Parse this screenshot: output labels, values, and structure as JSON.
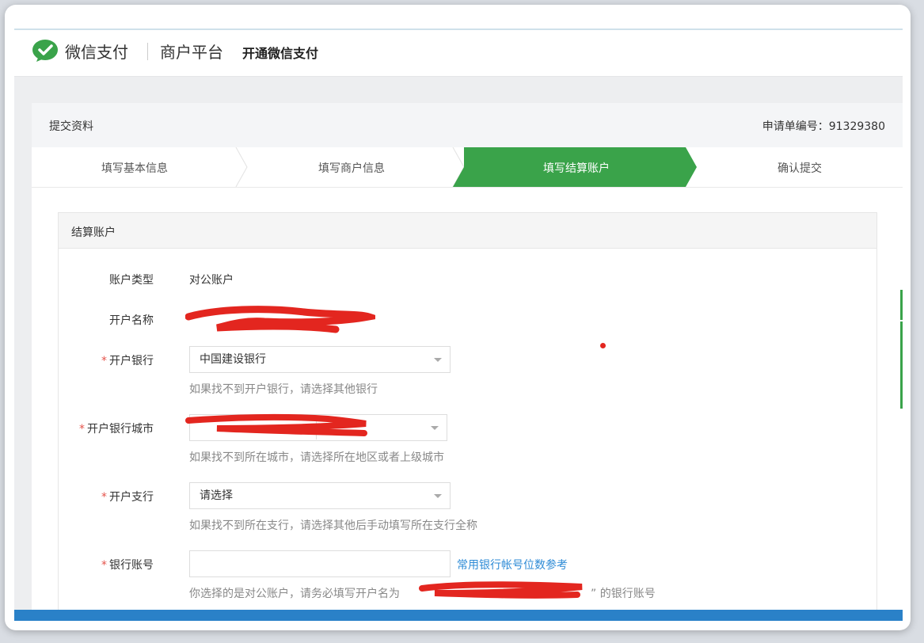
{
  "header": {
    "brand": "微信支付",
    "platform": "商户平台",
    "subtitle": "开通微信支付"
  },
  "panel": {
    "title": "提交资料",
    "application_no": "申请单编号：91329380"
  },
  "steps": [
    {
      "label": "填写基本信息",
      "active": false
    },
    {
      "label": "填写商户信息",
      "active": false
    },
    {
      "label": "填写结算账户",
      "active": true
    },
    {
      "label": "确认提交",
      "active": false
    }
  ],
  "section": {
    "title": "结算账户"
  },
  "form": {
    "account_type": {
      "label": "账户类型",
      "value": "对公账户"
    },
    "account_name": {
      "label": "开户名称"
    },
    "bank": {
      "label": "开户银行",
      "value": "中国建设银行",
      "hint": "如果找不到开户银行，请选择其他银行"
    },
    "bank_city": {
      "label": "开户银行城市",
      "hint": "如果找不到所在城市，请选择所在地区或者上级城市"
    },
    "branch": {
      "label": "开户支行",
      "value": "请选择",
      "hint": "如果找不到所在支行，请选择其他后手动填写所在支行全称"
    },
    "account_no": {
      "label": "银行账号",
      "value": "",
      "link": "常用银行帐号位数参考",
      "hint_prefix": "你选择的是对公账户，请务必填写开户名为",
      "hint_suffix": "” 的银行账号"
    }
  },
  "colors": {
    "wechat_green": "#3aa34a",
    "required_red": "#e5534b",
    "link_blue": "#2e8bd6"
  }
}
